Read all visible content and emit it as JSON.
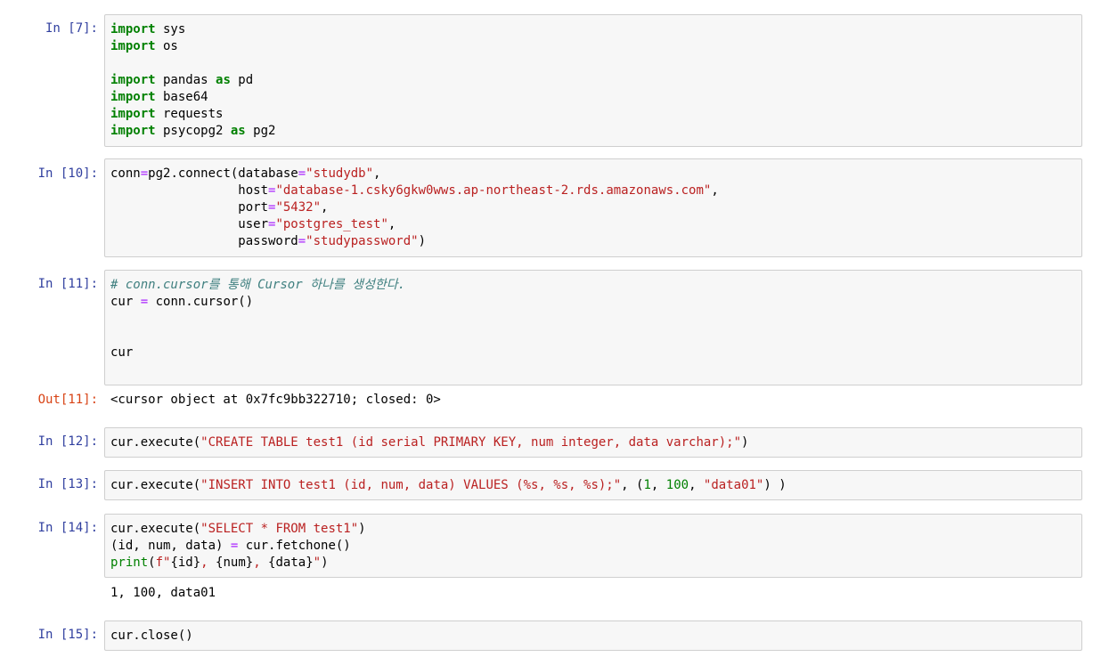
{
  "cells": [
    {
      "prompt": "In [7]:",
      "lines": [
        [
          {
            "t": "import",
            "c": "kw"
          },
          {
            "t": " sys",
            "c": ""
          }
        ],
        [
          {
            "t": "import",
            "c": "kw"
          },
          {
            "t": " os",
            "c": ""
          }
        ],
        [],
        [
          {
            "t": "import",
            "c": "kw"
          },
          {
            "t": " pandas ",
            "c": ""
          },
          {
            "t": "as",
            "c": "kw"
          },
          {
            "t": " pd",
            "c": ""
          }
        ],
        [
          {
            "t": "import",
            "c": "kw"
          },
          {
            "t": " base64",
            "c": ""
          }
        ],
        [
          {
            "t": "import",
            "c": "kw"
          },
          {
            "t": " requests",
            "c": ""
          }
        ],
        [
          {
            "t": "import",
            "c": "kw"
          },
          {
            "t": " psycopg2 ",
            "c": ""
          },
          {
            "t": "as",
            "c": "kw"
          },
          {
            "t": " pg2",
            "c": ""
          }
        ]
      ]
    },
    {
      "prompt": "In [10]:",
      "lines": [
        [
          {
            "t": "conn",
            "c": ""
          },
          {
            "t": "=",
            "c": "op"
          },
          {
            "t": "pg2.connect(database",
            "c": ""
          },
          {
            "t": "=",
            "c": "op"
          },
          {
            "t": "\"studydb\"",
            "c": "str"
          },
          {
            "t": ",",
            "c": ""
          }
        ],
        [
          {
            "t": "                 host",
            "c": ""
          },
          {
            "t": "=",
            "c": "op"
          },
          {
            "t": "\"database-1.csky6gkw0wws.ap-northeast-2.rds.amazonaws.com\"",
            "c": "str"
          },
          {
            "t": ",",
            "c": ""
          }
        ],
        [
          {
            "t": "                 port",
            "c": ""
          },
          {
            "t": "=",
            "c": "op"
          },
          {
            "t": "\"5432\"",
            "c": "str"
          },
          {
            "t": ",",
            "c": ""
          }
        ],
        [
          {
            "t": "                 user",
            "c": ""
          },
          {
            "t": "=",
            "c": "op"
          },
          {
            "t": "\"postgres_test\"",
            "c": "str"
          },
          {
            "t": ",",
            "c": ""
          }
        ],
        [
          {
            "t": "                 password",
            "c": ""
          },
          {
            "t": "=",
            "c": "op"
          },
          {
            "t": "\"studypassword\"",
            "c": "str"
          },
          {
            "t": ")",
            "c": ""
          }
        ]
      ]
    },
    {
      "prompt": "In [11]:",
      "lines": [
        [
          {
            "t": "# conn.cursor를 통해 Cursor 하나를 생성한다.",
            "c": "cm"
          }
        ],
        [
          {
            "t": "cur ",
            "c": ""
          },
          {
            "t": "=",
            "c": "op"
          },
          {
            "t": " conn.cursor()",
            "c": ""
          }
        ],
        [],
        [],
        [
          {
            "t": "cur",
            "c": ""
          }
        ]
      ],
      "output": "<cursor object at 0x7fc9bb322710; closed: 0>",
      "output_prompt": "Out[11]:"
    },
    {
      "prompt": "In [12]:",
      "lines": [
        [
          {
            "t": "cur.execute(",
            "c": ""
          },
          {
            "t": "\"CREATE TABLE test1 (id serial PRIMARY KEY, num integer, data varchar);\"",
            "c": "str"
          },
          {
            "t": ")",
            "c": ""
          }
        ]
      ]
    },
    {
      "prompt": "In [13]:",
      "lines": [
        [
          {
            "t": "cur.execute(",
            "c": ""
          },
          {
            "t": "\"INSERT INTO test1 (id, num, data) VALUES (%s, %s, %s);\"",
            "c": "str"
          },
          {
            "t": ", (",
            "c": ""
          },
          {
            "t": "1",
            "c": "nm"
          },
          {
            "t": ", ",
            "c": ""
          },
          {
            "t": "100",
            "c": "nm"
          },
          {
            "t": ", ",
            "c": ""
          },
          {
            "t": "\"data01\"",
            "c": "str"
          },
          {
            "t": ") )",
            "c": ""
          }
        ]
      ]
    },
    {
      "prompt": "In [14]:",
      "lines": [
        [
          {
            "t": "cur.execute(",
            "c": ""
          },
          {
            "t": "\"SELECT * FROM test1\"",
            "c": "str"
          },
          {
            "t": ")",
            "c": ""
          }
        ],
        [
          {
            "t": "(id, num, data) ",
            "c": ""
          },
          {
            "t": "=",
            "c": "op"
          },
          {
            "t": " cur.fetchone()",
            "c": ""
          }
        ],
        [
          {
            "t": "print",
            "c": "kw2"
          },
          {
            "t": "(",
            "c": ""
          },
          {
            "t": "f\"",
            "c": "str"
          },
          {
            "t": "{id}",
            "c": ""
          },
          {
            "t": ", ",
            "c": "str"
          },
          {
            "t": "{num}",
            "c": ""
          },
          {
            "t": ", ",
            "c": "str"
          },
          {
            "t": "{data}",
            "c": ""
          },
          {
            "t": "\"",
            "c": "str"
          },
          {
            "t": ")",
            "c": ""
          }
        ]
      ],
      "output": "1, 100, data01"
    },
    {
      "prompt": "In [15]:",
      "lines": [
        [
          {
            "t": "cur.close()",
            "c": ""
          }
        ]
      ]
    }
  ]
}
